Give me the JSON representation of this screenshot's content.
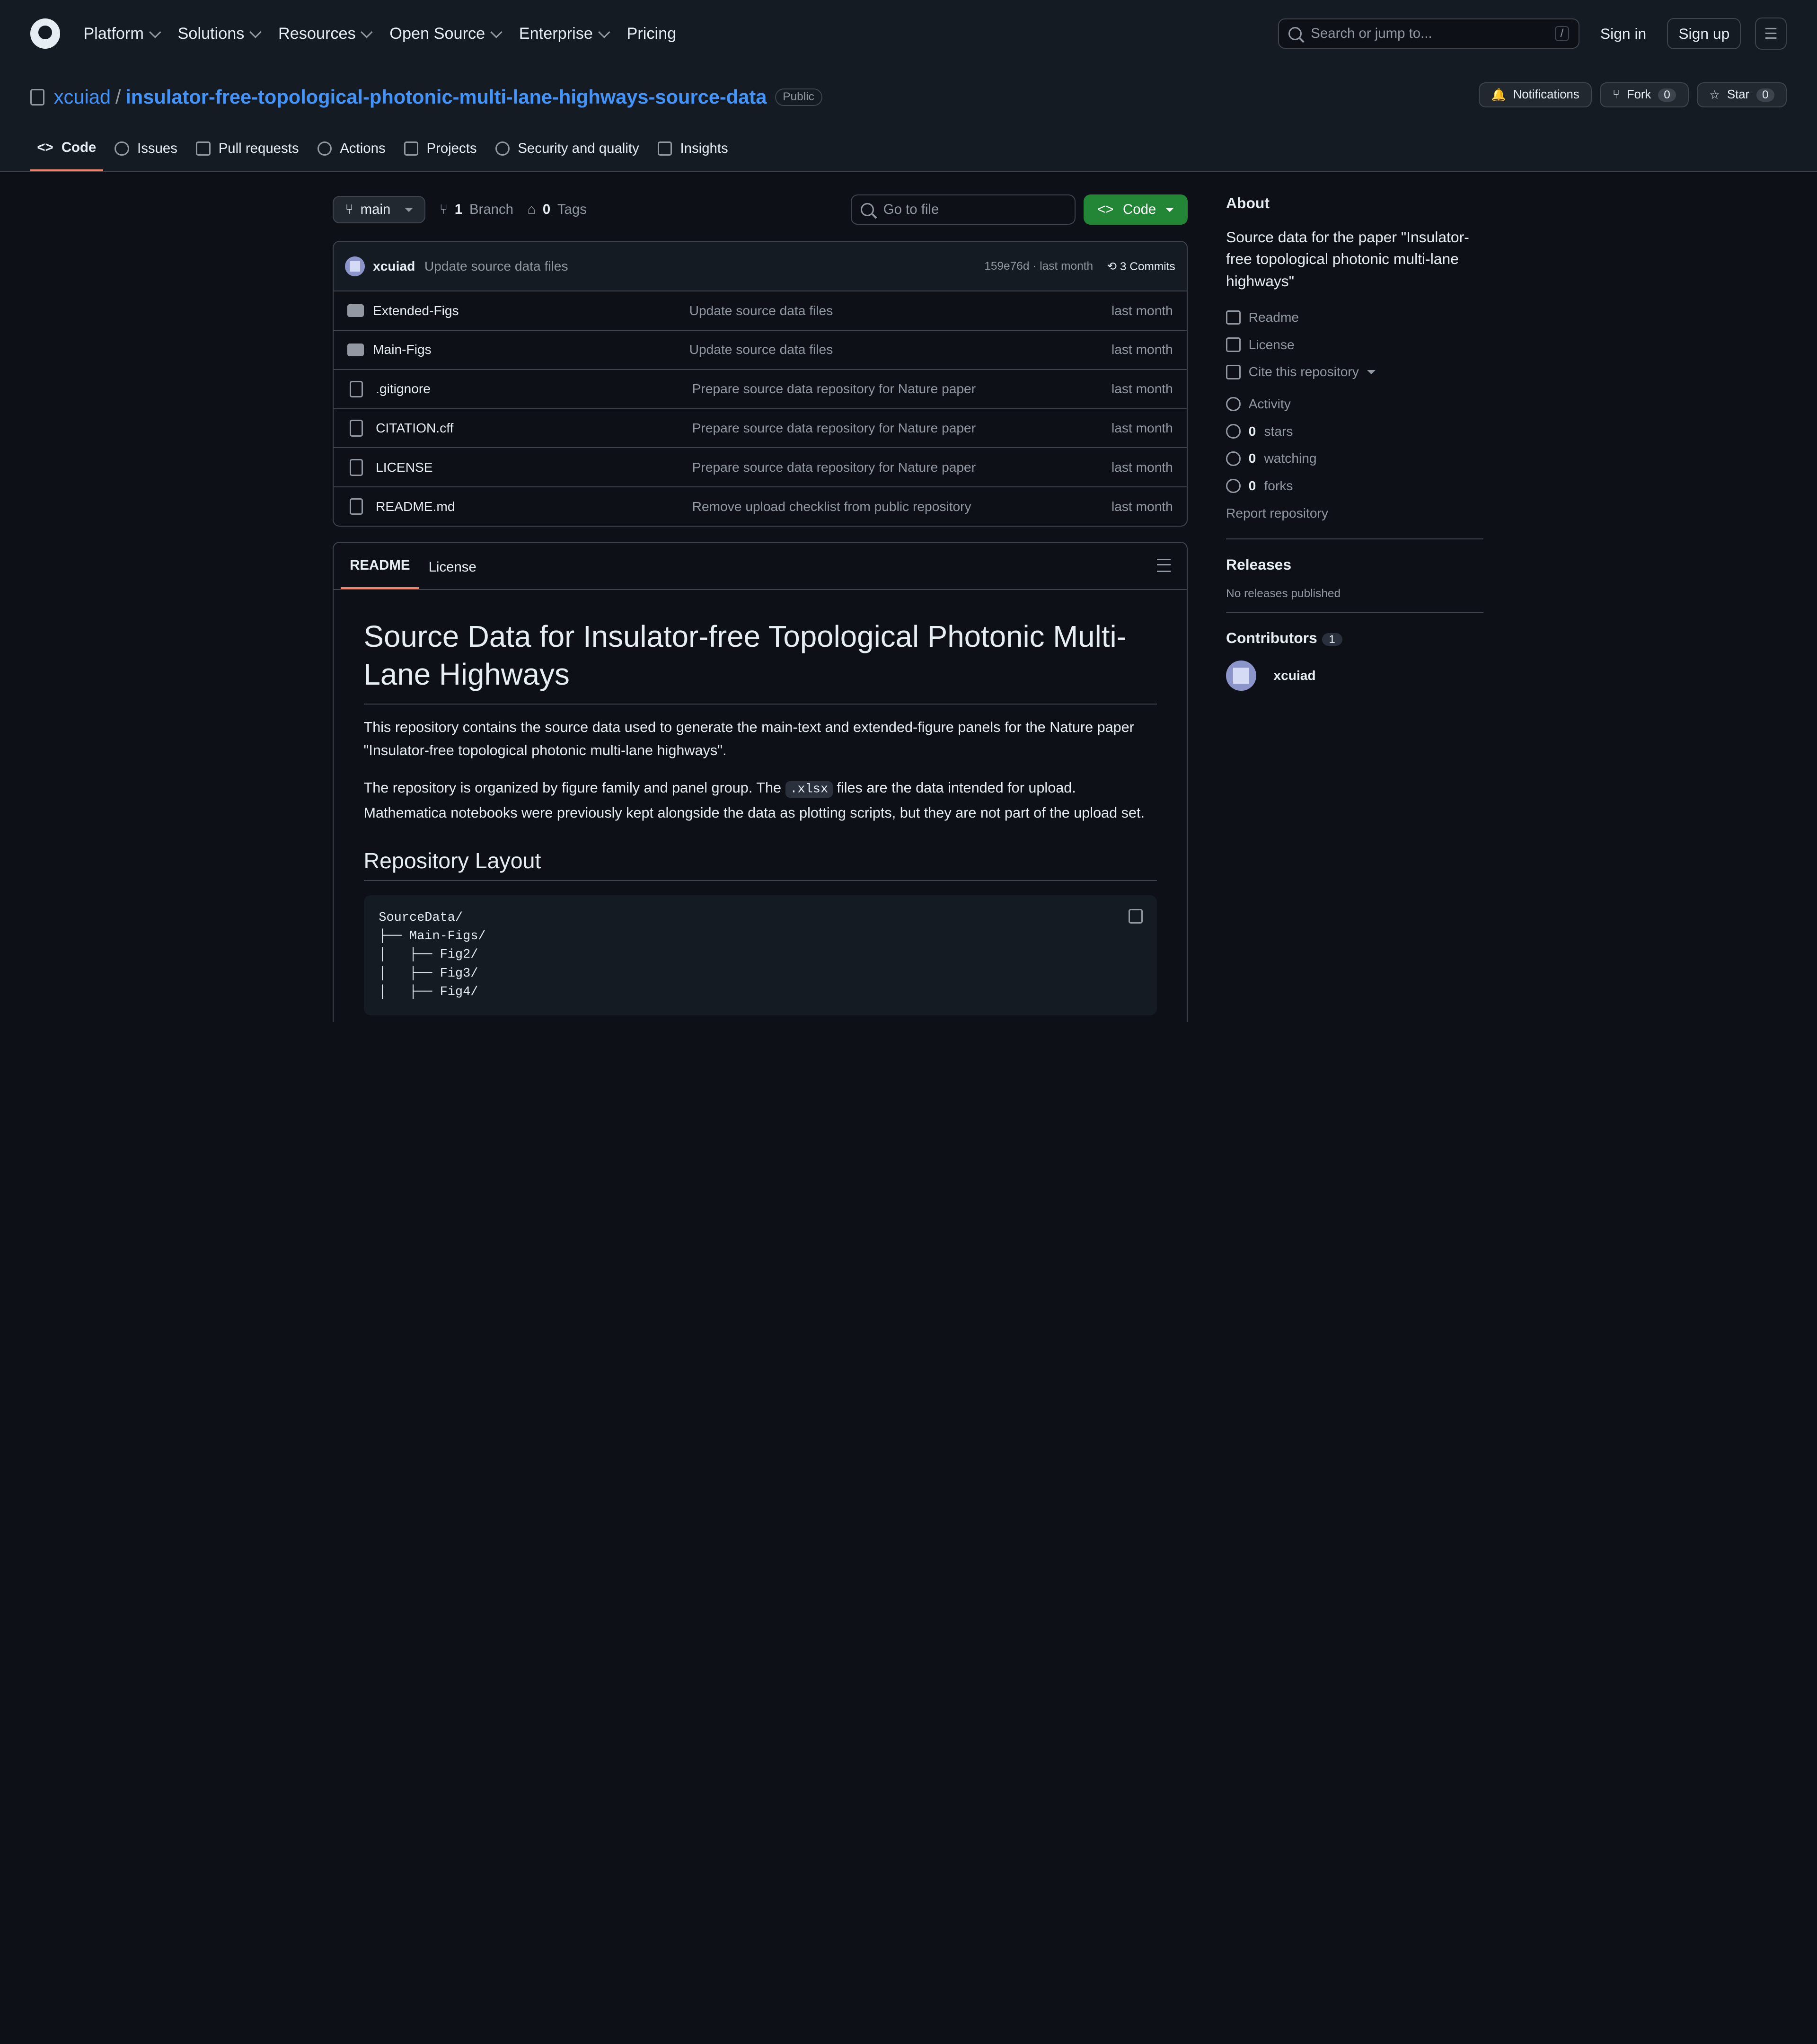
{
  "header": {
    "nav": [
      "Platform",
      "Solutions",
      "Resources",
      "Open Source",
      "Enterprise",
      "Pricing"
    ],
    "search_placeholder": "Search or jump to...",
    "search_shortcut": "/",
    "signin": "Sign in",
    "signup": "Sign up"
  },
  "repo": {
    "owner": "xcuiad",
    "name": "insulator-free-topological-photonic-multi-lane-highways-source-data",
    "visibility": "Public",
    "actions": {
      "notifications": "Notifications",
      "fork": "Fork",
      "fork_count": "0",
      "star": "Star",
      "star_count": "0"
    },
    "tabs": [
      "Code",
      "Issues",
      "Pull requests",
      "Actions",
      "Projects",
      "Security and quality",
      "Insights"
    ]
  },
  "toolbar": {
    "branch": "main",
    "branch_count": "1",
    "branch_label": "Branch",
    "tag_count": "0",
    "tag_label": "Tags",
    "gofile_placeholder": "Go to file",
    "code_button": "Code"
  },
  "commit": {
    "author": "xcuiad",
    "message": "Update source data files",
    "hash_date": "159e76d · last month",
    "commits": "3 Commits"
  },
  "files": [
    {
      "name": "Extended-Figs",
      "type": "folder",
      "message": "Update source data files",
      "date": "last month"
    },
    {
      "name": "Main-Figs",
      "type": "folder",
      "message": "Update source data files",
      "date": "last month"
    },
    {
      "name": ".gitignore",
      "type": "file",
      "message": "Prepare source data repository for Nature paper",
      "date": "last month"
    },
    {
      "name": "CITATION.cff",
      "type": "file",
      "message": "Prepare source data repository for Nature paper",
      "date": "last month"
    },
    {
      "name": "LICENSE",
      "type": "file",
      "message": "Prepare source data repository for Nature paper",
      "date": "last month"
    },
    {
      "name": "README.md",
      "type": "file",
      "message": "Remove upload checklist from public repository",
      "date": "last month"
    }
  ],
  "readme": {
    "tabs": [
      "README",
      "License"
    ],
    "title": "Source Data for Insulator-free Topological Photonic Multi-Lane Highways",
    "p1": "This repository contains the source data used to generate the main-text and extended-figure panels for the Nature paper \"Insulator-free topological photonic multi-lane highways\".",
    "p2_a": "The repository is organized by figure family and panel group. The ",
    "p2_code": ".xlsx",
    "p2_b": " files are the data intended for upload. Mathematica notebooks were previously kept alongside the data as plotting scripts, but they are not part of the upload set.",
    "h2": "Repository Layout",
    "code_block": "SourceData/\n├── Main-Figs/\n│   ├── Fig2/\n│   ├── Fig3/\n│   ├── Fig4/"
  },
  "sidebar": {
    "about_title": "About",
    "description": "Source data for the paper \"Insulator-free topological photonic multi-lane highways\"",
    "links": [
      "Readme",
      "License",
      "Cite this repository"
    ],
    "activity": "Activity",
    "stars_count": "0",
    "stars_label": "stars",
    "watching_count": "0",
    "watching_label": "watching",
    "forks_count": "0",
    "forks_label": "forks",
    "report": "Report repository",
    "releases_title": "Releases",
    "releases_empty": "No releases published",
    "contributors_title": "Contributors",
    "contributors_count": "1",
    "contributor": "xcuiad"
  }
}
